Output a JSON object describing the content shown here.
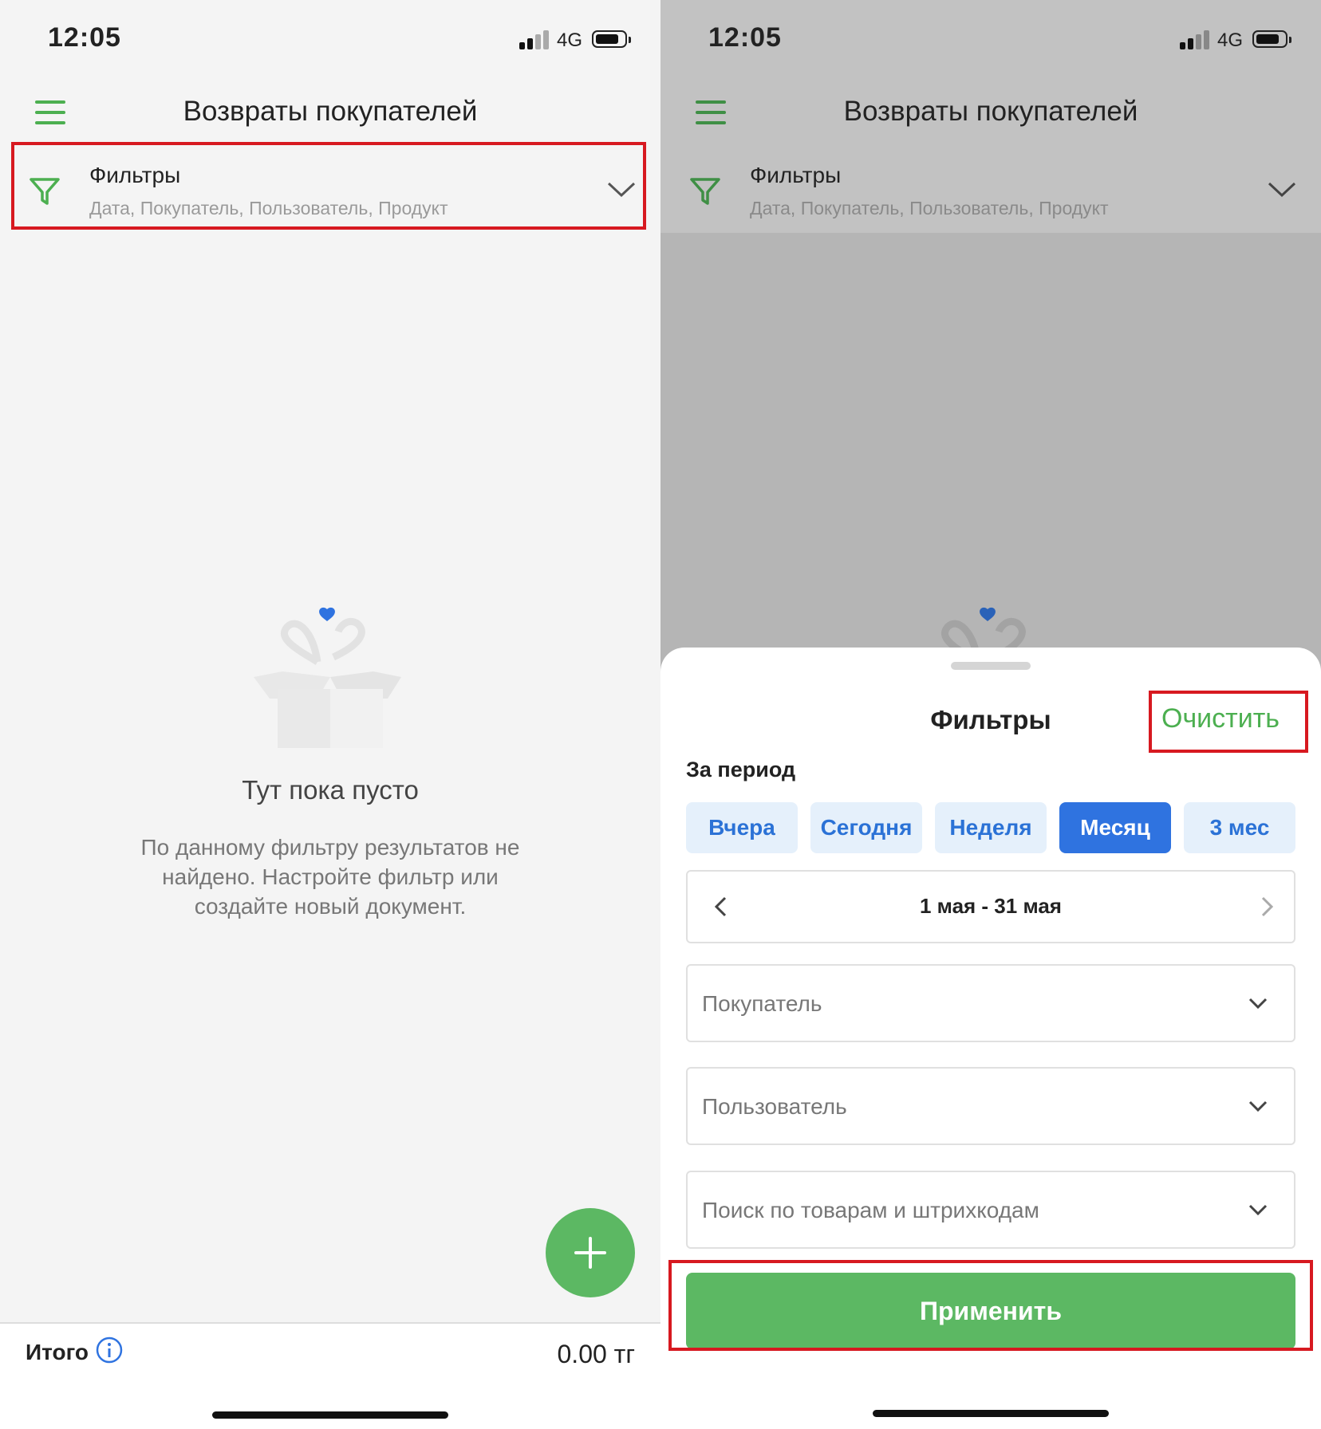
{
  "status": {
    "time": "12:05",
    "network": "4G"
  },
  "header": {
    "title": "Возвраты покупателей"
  },
  "filters_bar": {
    "label": "Фильтры",
    "summary": "Дата, Покупатель, Пользователь, Продукт"
  },
  "empty_state": {
    "title": "Тут пока пусто",
    "description": "По данному фильтру результатов не найдено. Настройте фильтр или создайте новый документ."
  },
  "footer": {
    "total_label": "Итого",
    "total_value": "0.00 тг"
  },
  "filter_sheet": {
    "title": "Фильтры",
    "clear_label": "Очистить",
    "period_label": "За период",
    "periods": [
      "Вчера",
      "Сегодня",
      "Неделя",
      "Месяц",
      "3 мес"
    ],
    "active_period": "Месяц",
    "date_range": "1 мая - 31 мая",
    "customer_placeholder": "Покупатель",
    "user_placeholder": "Пользователь",
    "product_placeholder": "Поиск по товарам и штрихкодам",
    "apply_label": "Применить"
  },
  "colors": {
    "accent_green": "#5cb863",
    "accent_blue": "#2f73e0",
    "highlight_red": "#d71920"
  }
}
